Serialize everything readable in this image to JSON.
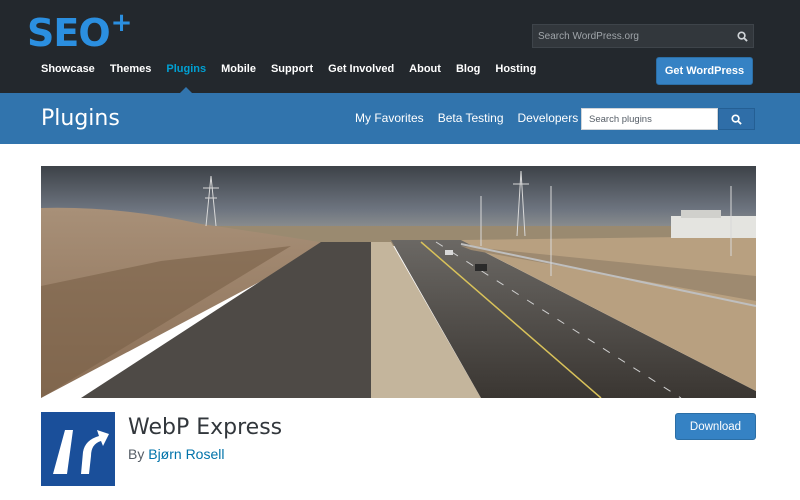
{
  "header": {
    "logo_text": "SEO",
    "logo_plus": "+",
    "search_placeholder": "Search WordPress.org",
    "nav": [
      {
        "label": "Showcase",
        "active": false
      },
      {
        "label": "Themes",
        "active": false
      },
      {
        "label": "Plugins",
        "active": true
      },
      {
        "label": "Mobile",
        "active": false
      },
      {
        "label": "Support",
        "active": false
      },
      {
        "label": "Get Involved",
        "active": false
      },
      {
        "label": "About",
        "active": false
      },
      {
        "label": "Blog",
        "active": false
      },
      {
        "label": "Hosting",
        "active": false
      }
    ],
    "cta_label": "Get WordPress"
  },
  "plugins_bar": {
    "title": "Plugins",
    "links": [
      "My Favorites",
      "Beta Testing",
      "Developers"
    ],
    "search_placeholder": "Search plugins"
  },
  "plugin": {
    "name": "WebP Express",
    "author_prefix": "By",
    "author": "Bjørn Rosell",
    "download_label": "Download"
  },
  "colors": {
    "top_bar": "#23282d",
    "accent_blue": "#3174ad",
    "button_blue": "#3582c4",
    "active_nav": "#00a0d2",
    "logo_blue": "#2b8fe0"
  }
}
